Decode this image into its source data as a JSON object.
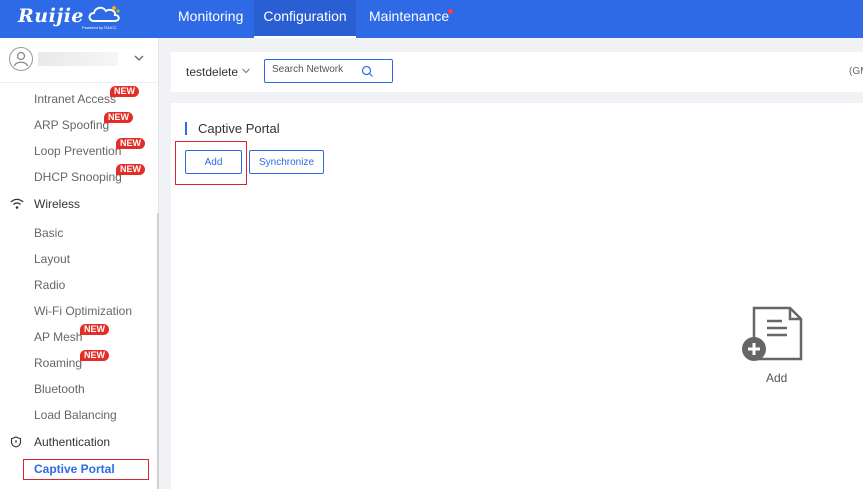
{
  "brand": {
    "name": "Ruijie",
    "tagline": "Powered by RAICC"
  },
  "nav": [
    {
      "label": "Monitoring"
    },
    {
      "label": "Configuration"
    },
    {
      "label": "Maintenance"
    }
  ],
  "sidebar": {
    "items": [
      {
        "label": "Intranet Access",
        "badge": "NEW"
      },
      {
        "label": "ARP Spoofing",
        "badge": "NEW"
      },
      {
        "label": "Loop Prevention",
        "badge": "NEW"
      },
      {
        "label": "DHCP Snooping",
        "badge": "NEW"
      },
      {
        "label": "Wireless",
        "icon": "wifi-icon"
      },
      {
        "label": "Basic"
      },
      {
        "label": "Layout"
      },
      {
        "label": "Radio"
      },
      {
        "label": "Wi-Fi Optimization"
      },
      {
        "label": "AP Mesh",
        "badge": "NEW"
      },
      {
        "label": "Roaming",
        "badge": "NEW"
      },
      {
        "label": "Bluetooth"
      },
      {
        "label": "Load Balancing"
      },
      {
        "label": "Authentication",
        "icon": "shield-icon"
      },
      {
        "label": "Captive Portal"
      }
    ]
  },
  "network": {
    "selected": "testdelete",
    "search_placeholder": "Search Network",
    "timezone": "(GM"
  },
  "main": {
    "title": "Captive Portal",
    "add_label": "Add",
    "sync_label": "Synchronize",
    "empty_add_label": "Add"
  },
  "colors": {
    "accent": "#2e6ae6",
    "highlight": "#d9262c",
    "badge": "#e52d27"
  }
}
